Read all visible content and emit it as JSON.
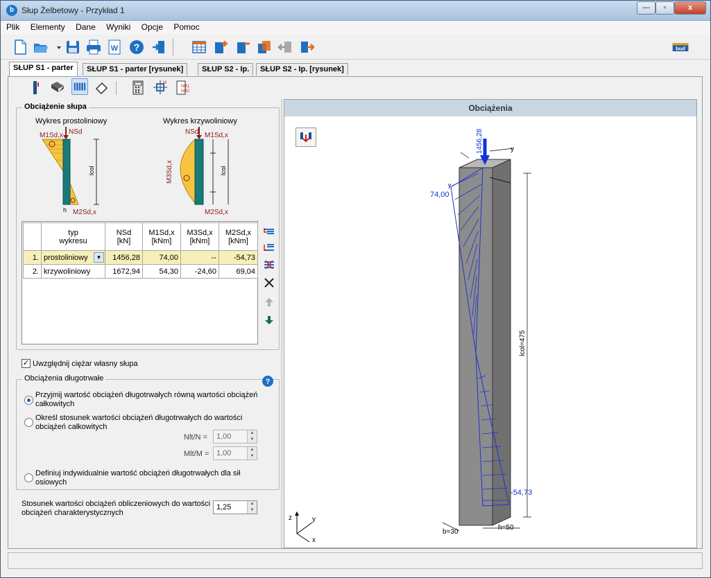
{
  "window": {
    "title": "Słup Żelbetowy - Przykład 1",
    "min_label": "—",
    "max_label": "▫",
    "close_label": "x"
  },
  "menu": [
    "Plik",
    "Elementy",
    "Dane",
    "Wyniki",
    "Opcje",
    "Pomoc"
  ],
  "brand_logo": "bud",
  "tabs": [
    "SŁUP S1 - parter",
    "SŁUP S1 - parter [rysunek]",
    "SŁUP S2 - Ip.",
    "SŁUP S2 - Ip. [rysunek]"
  ],
  "load_group": {
    "title": "Obciążenie słupa",
    "diagram_linear": "Wykres prostoliniowy",
    "diagram_curved": "Wykres krzywoliniowy",
    "labels": {
      "nsd": "NSd",
      "m1": "M1Sd,x",
      "m2": "M2Sd,x",
      "m3": "M3Sd,x",
      "lcol": "lcol",
      "h": "h"
    }
  },
  "table": {
    "headers": [
      {
        "l1": "typ",
        "l2": "wykresu"
      },
      {
        "l1": "NSd",
        "l2": "[kN]"
      },
      {
        "l1": "M1Sd,x",
        "l2": "[kNm]"
      },
      {
        "l1": "M3Sd,x",
        "l2": "[kNm]"
      },
      {
        "l1": "M2Sd,x",
        "l2": "[kNm]"
      }
    ],
    "rows": [
      {
        "idx": "1.",
        "type": "prostoliniowy",
        "nsd": "1456,28",
        "m1": "74,00",
        "m3": "--",
        "m2": "-54,73"
      },
      {
        "idx": "2.",
        "type": "krzywoliniowy",
        "nsd": "1672,94",
        "m1": "54,30",
        "m3": "-24,60",
        "m2": "69,04"
      }
    ]
  },
  "self_weight_label": "Uwzględnij ciężar własny słupa",
  "longterm": {
    "title": "Obciążenia długotrwałe",
    "opt1": [
      "Przyjmij wartość obciążeń długotrwałych równą wartości obciążeń",
      "całkowitych"
    ],
    "opt2": [
      "Określ stosunek wartości obciążeń długotrwałych do wartości",
      "obciążeń całkowitych"
    ],
    "nlt_label": "Nlt/N =",
    "nlt_value": "1,00",
    "mlt_label": "Mlt/M =",
    "mlt_value": "1,00",
    "opt3": [
      "Definiuj indywidualnie wartość obciążeń długotrwałych dla sił",
      "osiowych"
    ]
  },
  "ratio": {
    "label": [
      "Stosunek wartości obciążeń obliczeniowych do wartości",
      "obciążeń charakterystycznych"
    ],
    "value": "1,25"
  },
  "right_panel": {
    "title": "Obciążenia",
    "force_label": "1456,28",
    "moment_top": "74,00",
    "moment_bottom": "-54,73",
    "lcol_label": "lcol=475",
    "b_label": "b=30",
    "h_label": "h=50",
    "axis_z": "z",
    "axis_y": "y",
    "axis_x": "x"
  }
}
